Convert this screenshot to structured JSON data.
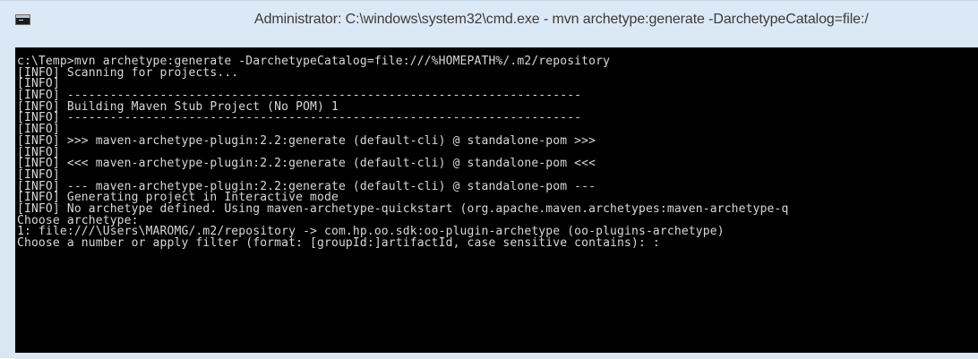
{
  "window": {
    "title": "Administrator: C:\\windows\\system32\\cmd.exe - mvn  archetype:generate -DarchetypeCatalog=file:/",
    "icon": "console-icon"
  },
  "console": {
    "lines": [
      "c:\\Temp>mvn archetype:generate -DarchetypeCatalog=file:///%HOMEPATH%/.m2/repository",
      "[INFO] Scanning for projects...",
      "[INFO]",
      "[INFO] ------------------------------------------------------------------------",
      "[INFO] Building Maven Stub Project (No POM) 1",
      "[INFO] ------------------------------------------------------------------------",
      "[INFO]",
      "[INFO] >>> maven-archetype-plugin:2.2:generate (default-cli) @ standalone-pom >>>",
      "[INFO]",
      "[INFO] <<< maven-archetype-plugin:2.2:generate (default-cli) @ standalone-pom <<<",
      "[INFO]",
      "[INFO] --- maven-archetype-plugin:2.2:generate (default-cli) @ standalone-pom ---",
      "[INFO] Generating project in Interactive mode",
      "[INFO] No archetype defined. Using maven-archetype-quickstart (org.apache.maven.archetypes:maven-archetype-q",
      "Choose archetype:",
      "1: file:///\\Users\\MAROMG/.m2/repository -> com.hp.oo.sdk:oo-plugin-archetype (oo-plugins-archetype)",
      "Choose a number or apply filter (format: [groupId:]artifactId, case sensitive contains): :"
    ]
  },
  "colors": {
    "titlebar": "#dbe8f5",
    "console_bg": "#000000",
    "console_text": "#d8d8d8"
  }
}
